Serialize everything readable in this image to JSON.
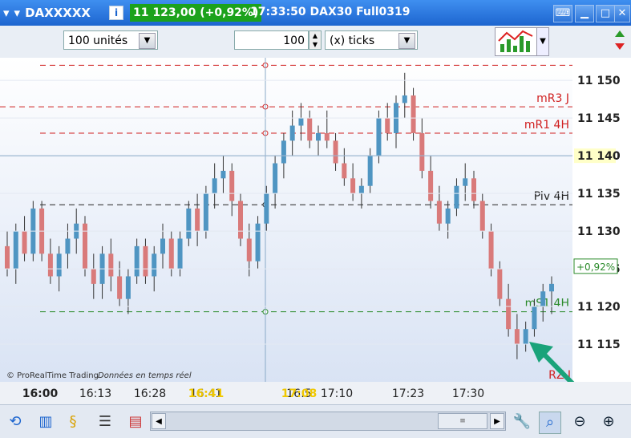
{
  "window": {
    "instrument": "DAXXXXX",
    "price_change": "11 123,00 (+0,92%)",
    "title": "17:33:50 DAX30 Full0319"
  },
  "toolbar": {
    "quantity_select": "100 unités",
    "ticks_value": "100",
    "ticks_select": "(x) ticks"
  },
  "chart": {
    "price_axis": [
      "11 150",
      "11 145",
      "11 140",
      "11 135",
      "11 130",
      "11 125",
      "11 120",
      "11 115"
    ],
    "current_price_label": "11 140",
    "change_badge": "+0,92%",
    "level_labels": {
      "mr3": "mR3 J",
      "mr1": "mR1 4H",
      "piv": "Piv 4H",
      "ms": "mS1 4H",
      "rz": "RZ J"
    },
    "time_axis": [
      "16:00",
      "16:13",
      "16:28",
      "16:41",
      "16:5",
      "17:10",
      "17:23",
      "17:30"
    ],
    "time_highlight": [
      "16:41",
      "17:08"
    ],
    "watermark": "© ProRealTime Trading",
    "watermark_italic": "Données en temps réel",
    "colors": {
      "up": "#4f95c2",
      "down": "#d97a7a",
      "red_line": "#d02020",
      "green_line": "#2a8a2a",
      "black_line": "#222222"
    }
  },
  "chart_data": {
    "type": "candlestick",
    "ylim": [
      11110,
      11153
    ],
    "levels": {
      "mR3 J": 11152,
      "mR3": 11146.5,
      "mR1 4H": 11143,
      "Piv 4H": 11133.5,
      "mS1 4H": 11119.3
    },
    "candles": [
      [
        11128,
        11130,
        11124,
        11125
      ],
      [
        11125,
        11131,
        11123,
        11130
      ],
      [
        11130,
        11132,
        11126,
        11127
      ],
      [
        11127,
        11134,
        11126,
        11133
      ],
      [
        11133,
        11134,
        11126,
        11127
      ],
      [
        11127,
        11129,
        11123,
        11124
      ],
      [
        11124,
        11128,
        11122,
        11127
      ],
      [
        11127,
        11131,
        11125,
        11129
      ],
      [
        11129,
        11133,
        11127,
        11131
      ],
      [
        11131,
        11132,
        11124,
        11125
      ],
      [
        11125,
        11127,
        11121,
        11123
      ],
      [
        11123,
        11128,
        11121,
        11127
      ],
      [
        11127,
        11129,
        11122,
        11124
      ],
      [
        11124,
        11126,
        11120,
        11121
      ],
      [
        11121,
        11125,
        11119,
        11124
      ],
      [
        11124,
        11129,
        11123,
        11128
      ],
      [
        11128,
        11129,
        11123,
        11124
      ],
      [
        11124,
        11128,
        11122,
        11127
      ],
      [
        11127,
        11131,
        11125,
        11129
      ],
      [
        11129,
        11130,
        11124,
        11125
      ],
      [
        11125,
        11130,
        11124,
        11129
      ],
      [
        11129,
        11134,
        11128,
        11133
      ],
      [
        11133,
        11135,
        11128,
        11130
      ],
      [
        11130,
        11136,
        11129,
        11135
      ],
      [
        11135,
        11139,
        11133,
        11137
      ],
      [
        11137,
        11140,
        11135,
        11138
      ],
      [
        11138,
        11139,
        11132,
        11134
      ],
      [
        11134,
        11135,
        11128,
        11129
      ],
      [
        11129,
        11131,
        11124,
        11126
      ],
      [
        11126,
        11132,
        11125,
        11131
      ],
      [
        11131,
        11136,
        11130,
        11135
      ],
      [
        11135,
        11140,
        11133,
        11139
      ],
      [
        11139,
        11143,
        11137,
        11142
      ],
      [
        11142,
        11146,
        11140,
        11144
      ],
      [
        11144,
        11147,
        11142,
        11145
      ],
      [
        11145,
        11146,
        11141,
        11142
      ],
      [
        11142,
        11144,
        11140,
        11143
      ],
      [
        11143,
        11146,
        11141,
        11142
      ],
      [
        11142,
        11143,
        11138,
        11139
      ],
      [
        11139,
        11141,
        11136,
        11137
      ],
      [
        11137,
        11139,
        11134,
        11135
      ],
      [
        11135,
        11137,
        11133,
        11136
      ],
      [
        11136,
        11141,
        11135,
        11140
      ],
      [
        11140,
        11146,
        11139,
        11145
      ],
      [
        11145,
        11147,
        11142,
        11143
      ],
      [
        11143,
        11148,
        11141,
        11147
      ],
      [
        11147,
        11151,
        11145,
        11148
      ],
      [
        11148,
        11149,
        11142,
        11143
      ],
      [
        11143,
        11145,
        11137,
        11138
      ],
      [
        11138,
        11140,
        11133,
        11134
      ],
      [
        11134,
        11136,
        11130,
        11131
      ],
      [
        11131,
        11134,
        11129,
        11133
      ],
      [
        11133,
        11137,
        11132,
        11136
      ],
      [
        11136,
        11139,
        11134,
        11137
      ],
      [
        11137,
        11138,
        11133,
        11134
      ],
      [
        11134,
        11135,
        11129,
        11130
      ],
      [
        11130,
        11131,
        11124,
        11125
      ],
      [
        11125,
        11126,
        11120,
        11121
      ],
      [
        11121,
        11123,
        11116,
        11117
      ],
      [
        11117,
        11119,
        11113,
        11115
      ],
      [
        11115,
        11118,
        11114,
        11117
      ],
      [
        11117,
        11121,
        11116,
        11120
      ],
      [
        11120,
        11123,
        11118,
        11122
      ],
      [
        11122,
        11124,
        11119,
        11123
      ]
    ]
  }
}
